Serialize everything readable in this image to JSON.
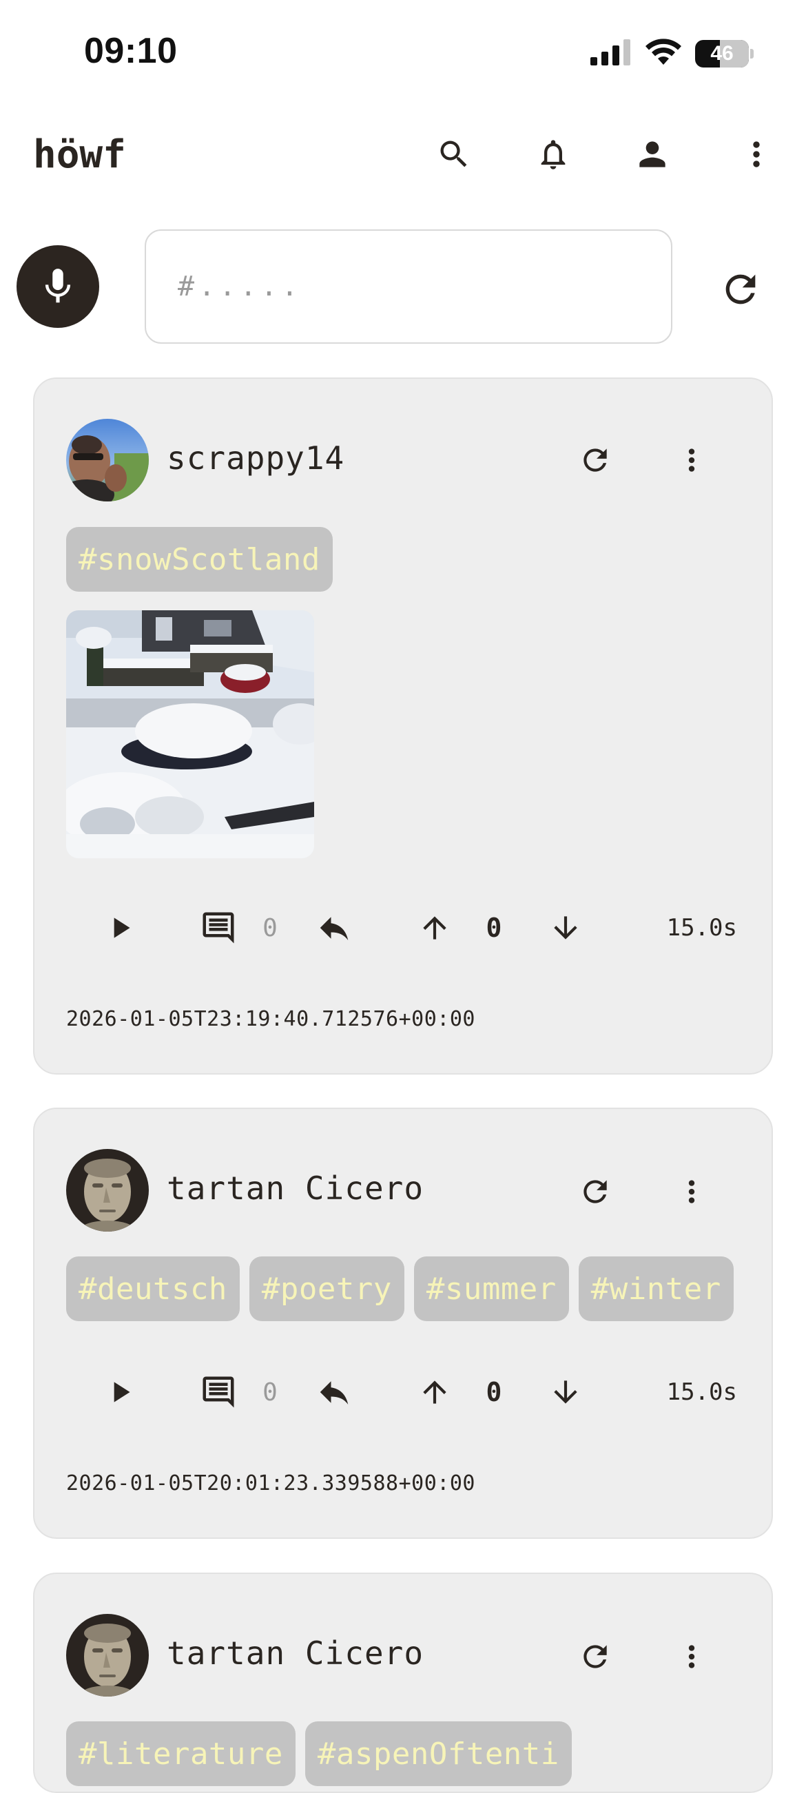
{
  "status_bar": {
    "time": "09:10",
    "battery_level": "46",
    "battery_fraction": 0.46
  },
  "app": {
    "logo": "höwf",
    "actions": [
      "search-icon",
      "bell-icon",
      "person-icon",
      "more-vert-icon"
    ]
  },
  "compose": {
    "tag_placeholder": "#.....",
    "tag_value": ""
  },
  "colors": {
    "card_background": "#eeeeee",
    "tag_chip_background": "#c3c3c3",
    "tag_chip_text": "#f7f4b8",
    "mic_button": "#2c2520",
    "icon_color": "#2a2521"
  },
  "posts": [
    {
      "username": "scrappy14",
      "tags": [
        "#snowScotland"
      ],
      "has_image": true,
      "comment_count": "0",
      "score": "0",
      "duration": "15.0s",
      "timestamp": "2026-01-05T23:19:40.712576+00:00"
    },
    {
      "username": "tartan Cicero",
      "tags": [
        "#deutsch",
        "#poetry",
        "#summer",
        "#winter"
      ],
      "has_image": false,
      "comment_count": "0",
      "score": "0",
      "duration": "15.0s",
      "timestamp": "2026-01-05T20:01:23.339588+00:00"
    },
    {
      "username": "tartan Cicero",
      "tags": [
        "#literature",
        "#aspenOftenti"
      ]
    }
  ]
}
